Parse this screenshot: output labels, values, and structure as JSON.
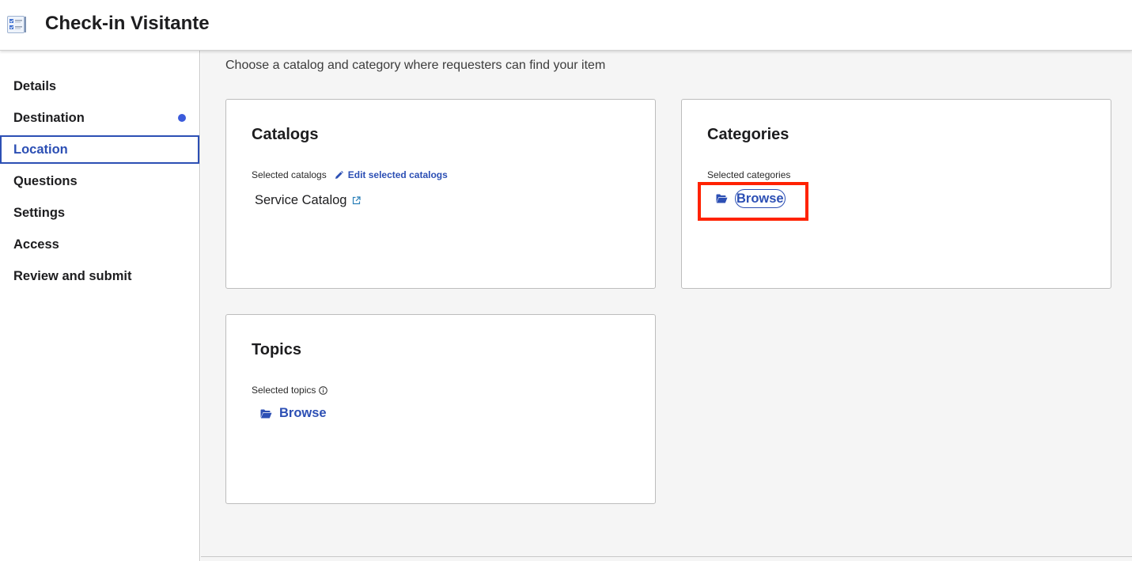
{
  "header": {
    "title": "Check-in Visitante"
  },
  "sidebar": {
    "items": [
      {
        "label": "Details"
      },
      {
        "label": "Destination",
        "indicator": true
      },
      {
        "label": "Location",
        "active": true
      },
      {
        "label": "Questions"
      },
      {
        "label": "Settings"
      },
      {
        "label": "Access"
      },
      {
        "label": "Review and submit"
      }
    ]
  },
  "main": {
    "intro": "Choose a catalog and category where requesters can find your item",
    "catalogs": {
      "title": "Catalogs",
      "selected_label": "Selected catalogs",
      "edit_label": "Edit selected catalogs",
      "value": "Service Catalog"
    },
    "categories": {
      "title": "Categories",
      "selected_label": "Selected categories",
      "browse_label": "Browse"
    },
    "topics": {
      "title": "Topics",
      "selected_label": "Selected topics",
      "browse_label": "Browse"
    }
  },
  "colors": {
    "accent": "#2c4fb4",
    "indicator_dot": "#3b5bdb",
    "highlight": "#ff2200",
    "main_background": "#f5f5f5"
  },
  "icons": [
    "checklist-icon",
    "pencil-icon",
    "external-link-icon",
    "folder-open-icon",
    "info-icon"
  ]
}
